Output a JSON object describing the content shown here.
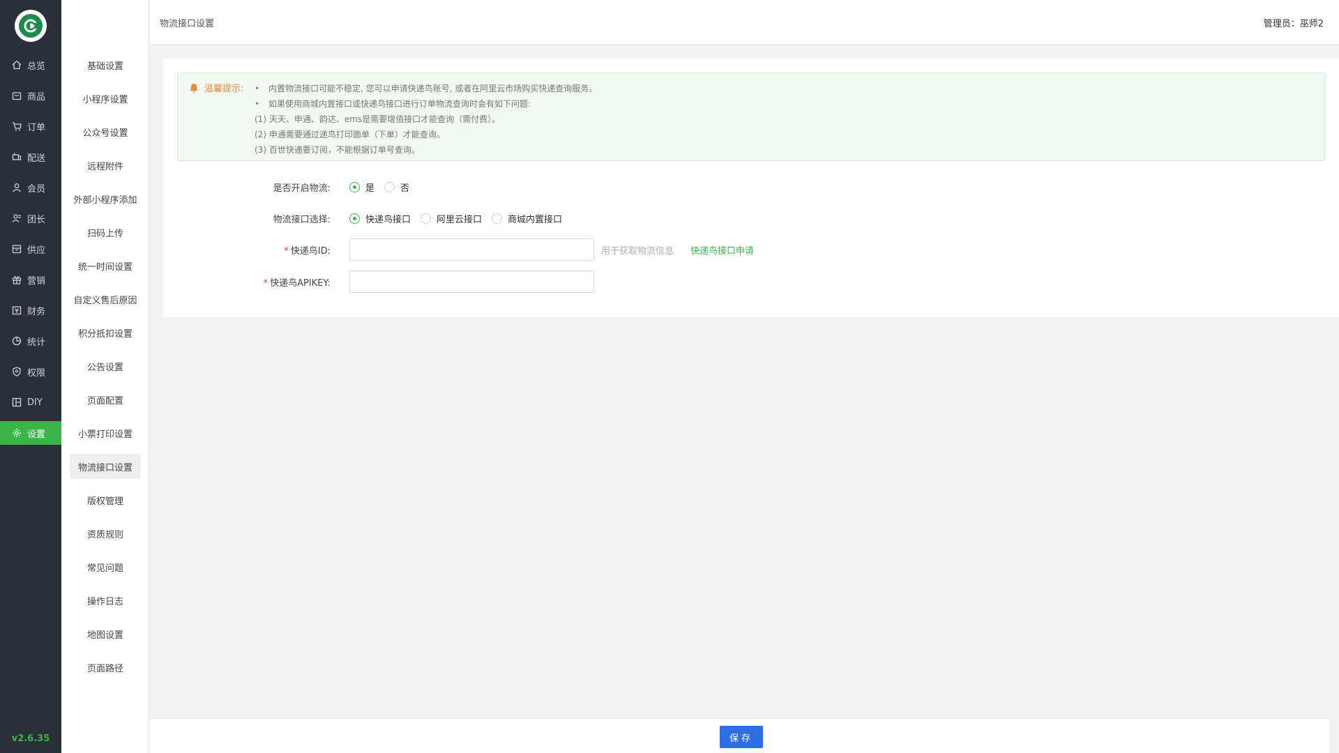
{
  "app": {
    "version": "v2.6.35",
    "brand_color": "#3ab54a",
    "rail_bg": "#2b2f3a"
  },
  "rail": {
    "items": [
      {
        "label": "总览",
        "icon": "home-icon"
      },
      {
        "label": "商品",
        "icon": "box-icon"
      },
      {
        "label": "订单",
        "icon": "order-icon"
      },
      {
        "label": "配送",
        "icon": "delivery-icon"
      },
      {
        "label": "会员",
        "icon": "user-icon"
      },
      {
        "label": "团长",
        "icon": "leader-icon"
      },
      {
        "label": "供应",
        "icon": "supply-icon"
      },
      {
        "label": "营销",
        "icon": "gift-icon"
      },
      {
        "label": "财务",
        "icon": "finance-icon"
      },
      {
        "label": "统计",
        "icon": "chart-icon"
      },
      {
        "label": "权限",
        "icon": "shield-icon"
      },
      {
        "label": "DIY",
        "icon": "layout-icon"
      },
      {
        "label": "设置",
        "icon": "gear-icon"
      }
    ],
    "active_label": "设置"
  },
  "subnav": {
    "items": [
      "基础设置",
      "小程序设置",
      "公众号设置",
      "远程附件",
      "外部小程序添加",
      "扫码上传",
      "统一时间设置",
      "自定义售后原因",
      "积分抵扣设置",
      "公告设置",
      "页面配置",
      "小票打印设置",
      "物流接口设置",
      "版权管理",
      "资质规则",
      "常见问题",
      "操作日志",
      "地图设置",
      "页面路径"
    ],
    "active": "物流接口设置"
  },
  "header": {
    "breadcrumb": "物流接口设置",
    "admin_label": "管理员：",
    "admin_name": "巫师2"
  },
  "tip": {
    "title": "温馨提示:",
    "lines": [
      "内置物流接口可能不稳定, 您可以申请快递鸟账号, 或者在阿里云市场购买快递查询服务。",
      "如果使用商城内置接口或快递鸟接口进行订单物流查询时会有如下问题:",
      "(1) 天天、申通、韵达、ems是需要增值接口才能查询（需付费）。",
      "(2) 申通需要通过递鸟打印面单（下单）才能查询。",
      "(3) 百世快递要订阅，不能根据订单号查询。"
    ]
  },
  "form": {
    "enable": {
      "label": "是否开启物流:",
      "options": [
        "是",
        "否"
      ],
      "selected": "是"
    },
    "provider": {
      "label": "物流接口选择:",
      "options": [
        "快递鸟接口",
        "阿里云接口",
        "商城内置接口"
      ],
      "selected": "快递鸟接口"
    },
    "kdn_id": {
      "label": "快递鸟ID:",
      "value": "",
      "hint": "用于获取物流信息",
      "link": "快递鸟接口申请"
    },
    "kdn_apikey": {
      "label": "快递鸟APIKEY:",
      "value": ""
    }
  },
  "footer": {
    "save_label": "保存"
  }
}
